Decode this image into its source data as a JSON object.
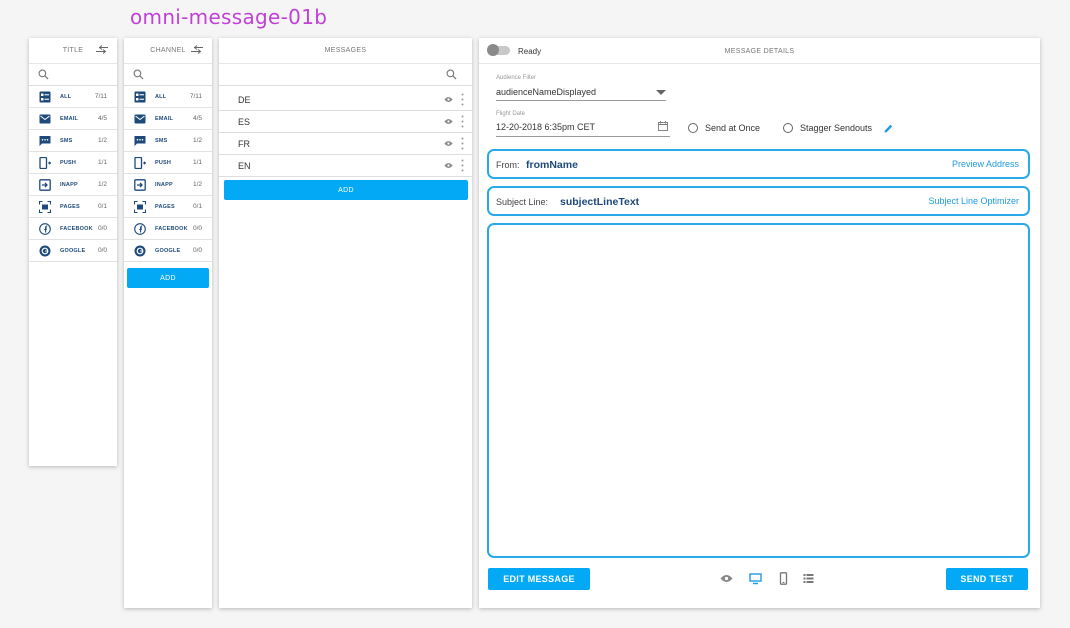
{
  "page_label": "omni-message-01b",
  "title_column": {
    "header": "TITLE",
    "items": [
      {
        "label": "ALL",
        "count": "7/11",
        "icon": "list-icon"
      },
      {
        "label": "EMAIL",
        "count": "4/5",
        "icon": "email-icon"
      },
      {
        "label": "SMS",
        "count": "1/2",
        "icon": "sms-icon"
      },
      {
        "label": "PUSH",
        "count": "1/1",
        "icon": "push-icon"
      },
      {
        "label": "INAPP",
        "count": "1/2",
        "icon": "inapp-icon"
      },
      {
        "label": "PAGES",
        "count": "0/1",
        "icon": "pages-icon"
      },
      {
        "label": "FACEBOOK",
        "count": "0/0",
        "icon": "facebook-icon"
      },
      {
        "label": "GOOGLE",
        "count": "0/0",
        "icon": "google-icon"
      }
    ]
  },
  "channel_column": {
    "header": "CHANNEL",
    "items": [
      {
        "label": "ALL",
        "count": "7/11",
        "icon": "list-icon"
      },
      {
        "label": "EMAIL",
        "count": "4/5",
        "icon": "email-icon"
      },
      {
        "label": "SMS",
        "count": "1/2",
        "icon": "sms-icon"
      },
      {
        "label": "PUSH",
        "count": "1/1",
        "icon": "push-icon"
      },
      {
        "label": "INAPP",
        "count": "1/2",
        "icon": "inapp-icon"
      },
      {
        "label": "PAGES",
        "count": "0/1",
        "icon": "pages-icon"
      },
      {
        "label": "FACEBOOK",
        "count": "0/0",
        "icon": "facebook-icon"
      },
      {
        "label": "GOOGLE",
        "count": "0/0",
        "icon": "google-icon"
      }
    ],
    "add_label": "ADD"
  },
  "messages_column": {
    "header": "MESSAGES",
    "items": [
      "DE",
      "ES",
      "FR",
      "EN"
    ],
    "add_label": "ADD"
  },
  "details": {
    "toggle_label": "Ready",
    "header": "MESSAGE DETAILS",
    "audience_filter_label": "Audience Filter",
    "audience_filter_value": "audienceNameDisplayed",
    "flight_date_label": "Flight Date",
    "flight_date_value": "12-20-2018  6:35pm  CET",
    "send_at_once": "Send at Once",
    "stagger_sendouts": "Stagger Sendouts",
    "from_prefix": "From:",
    "from_value": "fromName",
    "preview_address": "Preview Address",
    "subject_prefix": "Subject Line:",
    "subject_value": "subjectLineText",
    "subject_optimizer": "Subject Line Optimizer",
    "edit_message": "EDIT MESSAGE",
    "send_test": "SEND TEST"
  },
  "colors": {
    "accent": "#03a9f4",
    "outline": "#29a9e8",
    "nav_text": "#1d4a7a",
    "page_label": "#c040d8"
  }
}
